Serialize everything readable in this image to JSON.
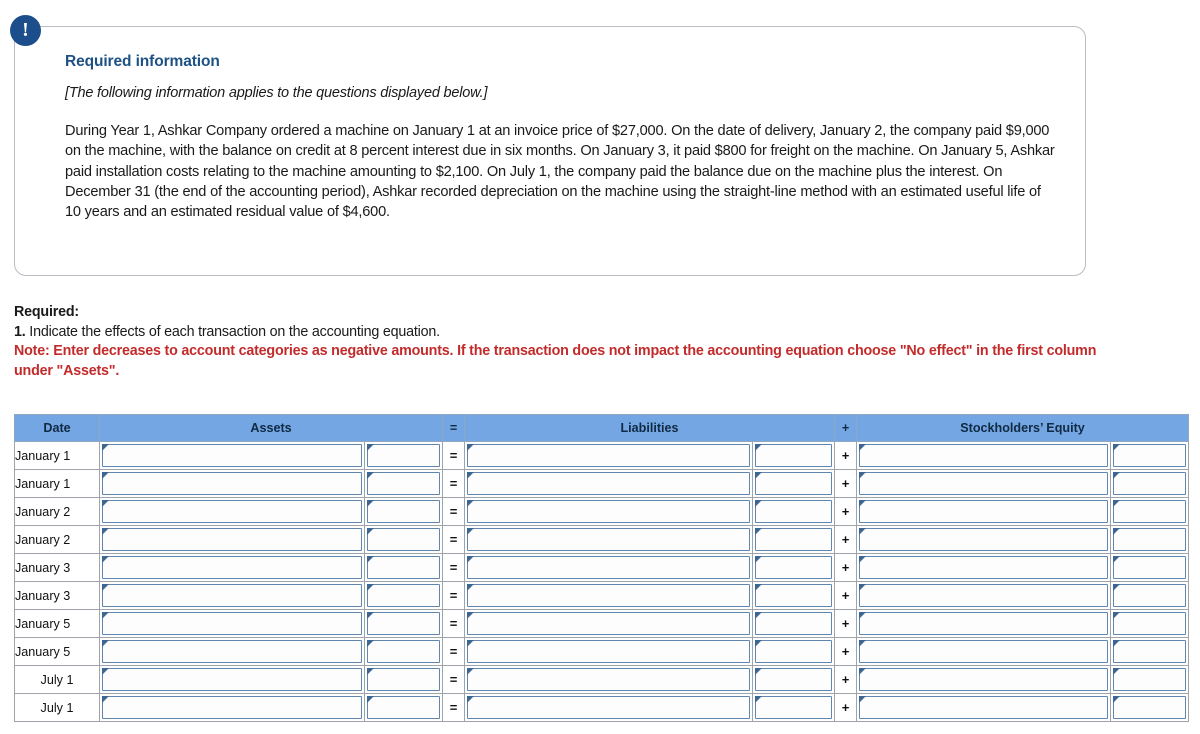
{
  "callout": {
    "alert_icon": "exclamation-icon",
    "heading": "Required information",
    "applies_note": "[The following information applies to the questions displayed below.]",
    "scenario": "During Year 1, Ashkar Company ordered a machine on January 1 at an invoice price of $27,000. On the date of delivery, January 2, the company paid $9,000 on the machine, with the balance on credit at 8 percent interest due in six months. On January 3, it paid $800 for freight on the machine. On January 5, Ashkar paid installation costs relating to the machine amounting to $2,100. On July 1, the company paid the balance due on the machine plus the interest. On December 31 (the end of the accounting period), Ashkar recorded depreciation on the machine using the straight-line method with an estimated useful life of 10 years and an estimated residual value of $4,600."
  },
  "required": {
    "label": "Required:",
    "item_number": "1.",
    "item_text": " Indicate the effects of each transaction on the accounting equation.",
    "note": "Note: Enter decreases to account categories as negative amounts. If the transaction does not impact the accounting equation choose \"No effect\" in the first column under \"Assets\"."
  },
  "worksheet": {
    "headers": {
      "date": "Date",
      "assets": "Assets",
      "equals": "=",
      "liabilities": "Liabilities",
      "plus": "+",
      "stockholders_equity": "Stockholders’ Equity"
    },
    "rows": [
      {
        "date": "January 1",
        "align": "align-left",
        "equals": "=",
        "plus": "+"
      },
      {
        "date": "January 1",
        "align": "align-left",
        "equals": "=",
        "plus": "+"
      },
      {
        "date": "January 2",
        "align": "align-left",
        "equals": "=",
        "plus": "+"
      },
      {
        "date": "January 2",
        "align": "align-left",
        "equals": "=",
        "plus": "+"
      },
      {
        "date": "January 3",
        "align": "align-left",
        "equals": "=",
        "plus": "+"
      },
      {
        "date": "January 3",
        "align": "align-left",
        "equals": "=",
        "plus": "+"
      },
      {
        "date": "January 5",
        "align": "align-left",
        "equals": "=",
        "plus": "+"
      },
      {
        "date": "January 5",
        "align": "align-left",
        "equals": "=",
        "plus": "+"
      },
      {
        "date": "July 1",
        "align": "align-center",
        "equals": "=",
        "plus": "+"
      },
      {
        "date": "July 1",
        "align": "align-center",
        "equals": "=",
        "plus": "+"
      }
    ]
  },
  "colors": {
    "header_blue": "#74a6e3",
    "heading_blue": "#1e5184",
    "note_red": "#c32b2b",
    "badge_navy": "#1c4e8c",
    "field_border": "#5f87b0"
  }
}
